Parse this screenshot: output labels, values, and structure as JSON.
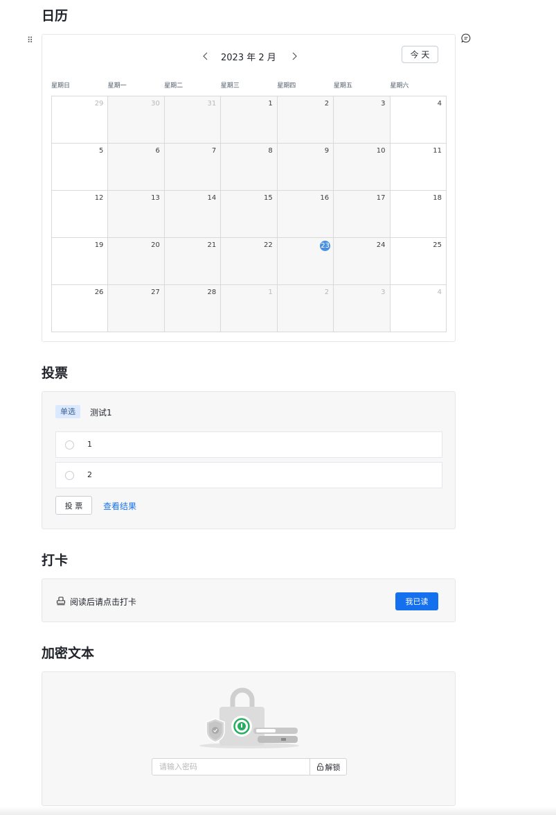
{
  "calendar": {
    "title": "日历",
    "month_label": "2023 年 2 月",
    "today_button": "今 天",
    "weekdays": [
      "星期日",
      "星期一",
      "星期二",
      "星期三",
      "星期四",
      "星期五",
      "星期六"
    ],
    "weeks": [
      [
        {
          "d": "29",
          "out": true
        },
        {
          "d": "30",
          "out": true
        },
        {
          "d": "31",
          "out": true
        },
        {
          "d": "1"
        },
        {
          "d": "2"
        },
        {
          "d": "3"
        },
        {
          "d": "4"
        }
      ],
      [
        {
          "d": "5"
        },
        {
          "d": "6"
        },
        {
          "d": "7"
        },
        {
          "d": "8"
        },
        {
          "d": "9"
        },
        {
          "d": "10"
        },
        {
          "d": "11"
        }
      ],
      [
        {
          "d": "12"
        },
        {
          "d": "13"
        },
        {
          "d": "14"
        },
        {
          "d": "15"
        },
        {
          "d": "16"
        },
        {
          "d": "17"
        },
        {
          "d": "18"
        }
      ],
      [
        {
          "d": "19"
        },
        {
          "d": "20"
        },
        {
          "d": "21"
        },
        {
          "d": "22"
        },
        {
          "d": "23",
          "today": true
        },
        {
          "d": "24"
        },
        {
          "d": "25"
        }
      ],
      [
        {
          "d": "26"
        },
        {
          "d": "27"
        },
        {
          "d": "28"
        },
        {
          "d": "1",
          "out": true
        },
        {
          "d": "2",
          "out": true
        },
        {
          "d": "3",
          "out": true
        },
        {
          "d": "4",
          "out": true
        }
      ]
    ],
    "today_color": "#4a90e2"
  },
  "vote": {
    "title": "投票",
    "tag": "单选",
    "question": "测试1",
    "options": [
      {
        "label": "1"
      },
      {
        "label": "2"
      }
    ],
    "vote_button": "投 票",
    "result_link": "查看结果"
  },
  "checkin": {
    "title": "打卡",
    "text": "阅读后请点击打卡",
    "button": "我已读",
    "button_color": "#1470ed"
  },
  "encrypted": {
    "title": "加密文本",
    "placeholder": "请输入密码",
    "unlock_button": "解锁"
  }
}
